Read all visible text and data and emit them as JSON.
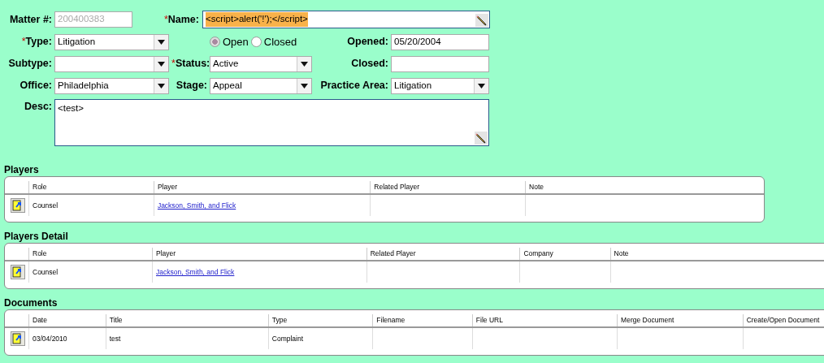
{
  "form": {
    "matter": {
      "label": "Matter #:",
      "kind": "text",
      "value": "200400383",
      "disabled": true
    },
    "name": {
      "label": "Name:",
      "required_mark": "*",
      "kind": "editor",
      "value": "<script>alert('!');</script>",
      "highlighted": true
    },
    "type": {
      "label": "Type:",
      "required_mark": "*",
      "kind": "select",
      "value": "Litigation"
    },
    "state_options": [
      {
        "label": "Open",
        "selected": true
      },
      {
        "label": "Closed",
        "selected": false
      }
    ],
    "opened": {
      "label": "Opened:",
      "kind": "text",
      "value": "05/20/2004"
    },
    "subtype": {
      "label": "Subtype:",
      "kind": "select"
    },
    "status": {
      "label": "Status:",
      "required_mark": "*",
      "kind": "select",
      "value": "Active"
    },
    "closed": {
      "label": "Closed:",
      "kind": "text"
    },
    "office": {
      "label": "Office:",
      "kind": "select",
      "value": "Philadelphia"
    },
    "stage": {
      "label": "Stage:",
      "kind": "select",
      "value": "Appeal"
    },
    "practice_area": {
      "label": "Practice Area:",
      "kind": "select",
      "value": "Litigation"
    },
    "desc": {
      "label": "Desc:",
      "kind": "memo",
      "value": "<test>"
    }
  },
  "sections": [
    {
      "title": "Players",
      "columns": [
        "Role",
        "Player",
        "Related Player",
        "Note"
      ],
      "rows": [
        {
          "cells": [
            {
              "text": "Counsel"
            },
            {
              "text": "Jackson, Smith, and Flick",
              "link": true
            }
          ]
        }
      ]
    },
    {
      "title": "Players Detail",
      "columns": [
        "Role",
        "Player",
        "Related Player",
        "Company",
        "Note"
      ],
      "rows": [
        {
          "cells": [
            {
              "text": "Counsel"
            },
            {
              "text": "Jackson, Smith, and Flick",
              "link": true
            }
          ]
        }
      ]
    },
    {
      "title": "Documents",
      "columns": [
        "Date",
        "Title",
        "Type",
        "Filename",
        "File URL",
        "Merge Document",
        "Create/Open Document"
      ],
      "rows": [
        {
          "cells": [
            {
              "text": "03/04/2010"
            },
            {
              "text": "test"
            },
            {
              "text": "Complaint"
            }
          ]
        }
      ]
    }
  ]
}
